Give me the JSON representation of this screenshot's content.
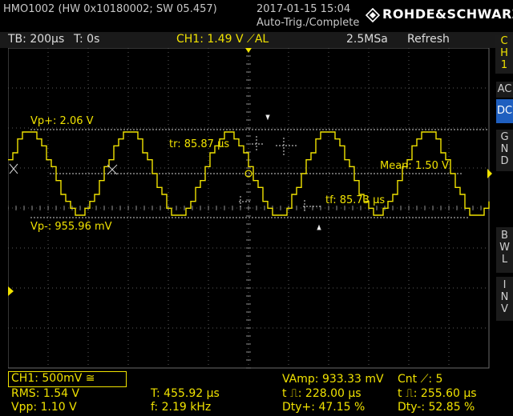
{
  "header": {
    "device": "HMO1002 (HW 0x10180002; SW 05.457)",
    "datetime": "2017-01-15 15:04",
    "trigger_status": "Auto-Trig./Complete",
    "brand": "ROHDE&SCHWARZ"
  },
  "status_bar": {
    "timebase": "TB: 200µs",
    "trigger_time": "T: 0s",
    "channel_trigger": "CH1: 1.49 V ⟋AL",
    "sample_rate": "2.5MSa",
    "mode": "Refresh"
  },
  "side_panel": {
    "channel": [
      "C",
      "H",
      "1"
    ],
    "ac": "AC",
    "dc": "DC",
    "gnd": [
      "G",
      "N",
      "D"
    ],
    "bwl": [
      "B",
      "W",
      "L"
    ],
    "inv": [
      "I",
      "N",
      "V"
    ]
  },
  "cursor_labels": {
    "vp_plus": "Vp+: 2.06 V",
    "vp_minus": "Vp-: 955.96 mV",
    "mean": "Mean: 1.50 V",
    "tr": "tr: 85.87 µs",
    "tf": "tf: 85.73 µs"
  },
  "measurements": {
    "ch1_setting": "CH1: 500mV ≅",
    "rms": "RMS: 1.54 V",
    "vpp": "Vpp: 1.10 V",
    "period": "T: 455.92 µs",
    "frequency": "f: 2.19 kHz",
    "vamp": "VAmp: 933.33 mV",
    "t_pos_pulse": "t ⎍: 228.00 µs",
    "duty_pos": "Dty+: 47.15 %",
    "count": "Cnt ⟋: 5",
    "t_neg_pulse": "t ⎍: 255.60 µs",
    "duty_neg": "Dty-: 52.85 %"
  },
  "colors": {
    "trace": "#f0e200",
    "grid": "#5a5a5a",
    "dc_active": "#1f5fbf"
  }
}
